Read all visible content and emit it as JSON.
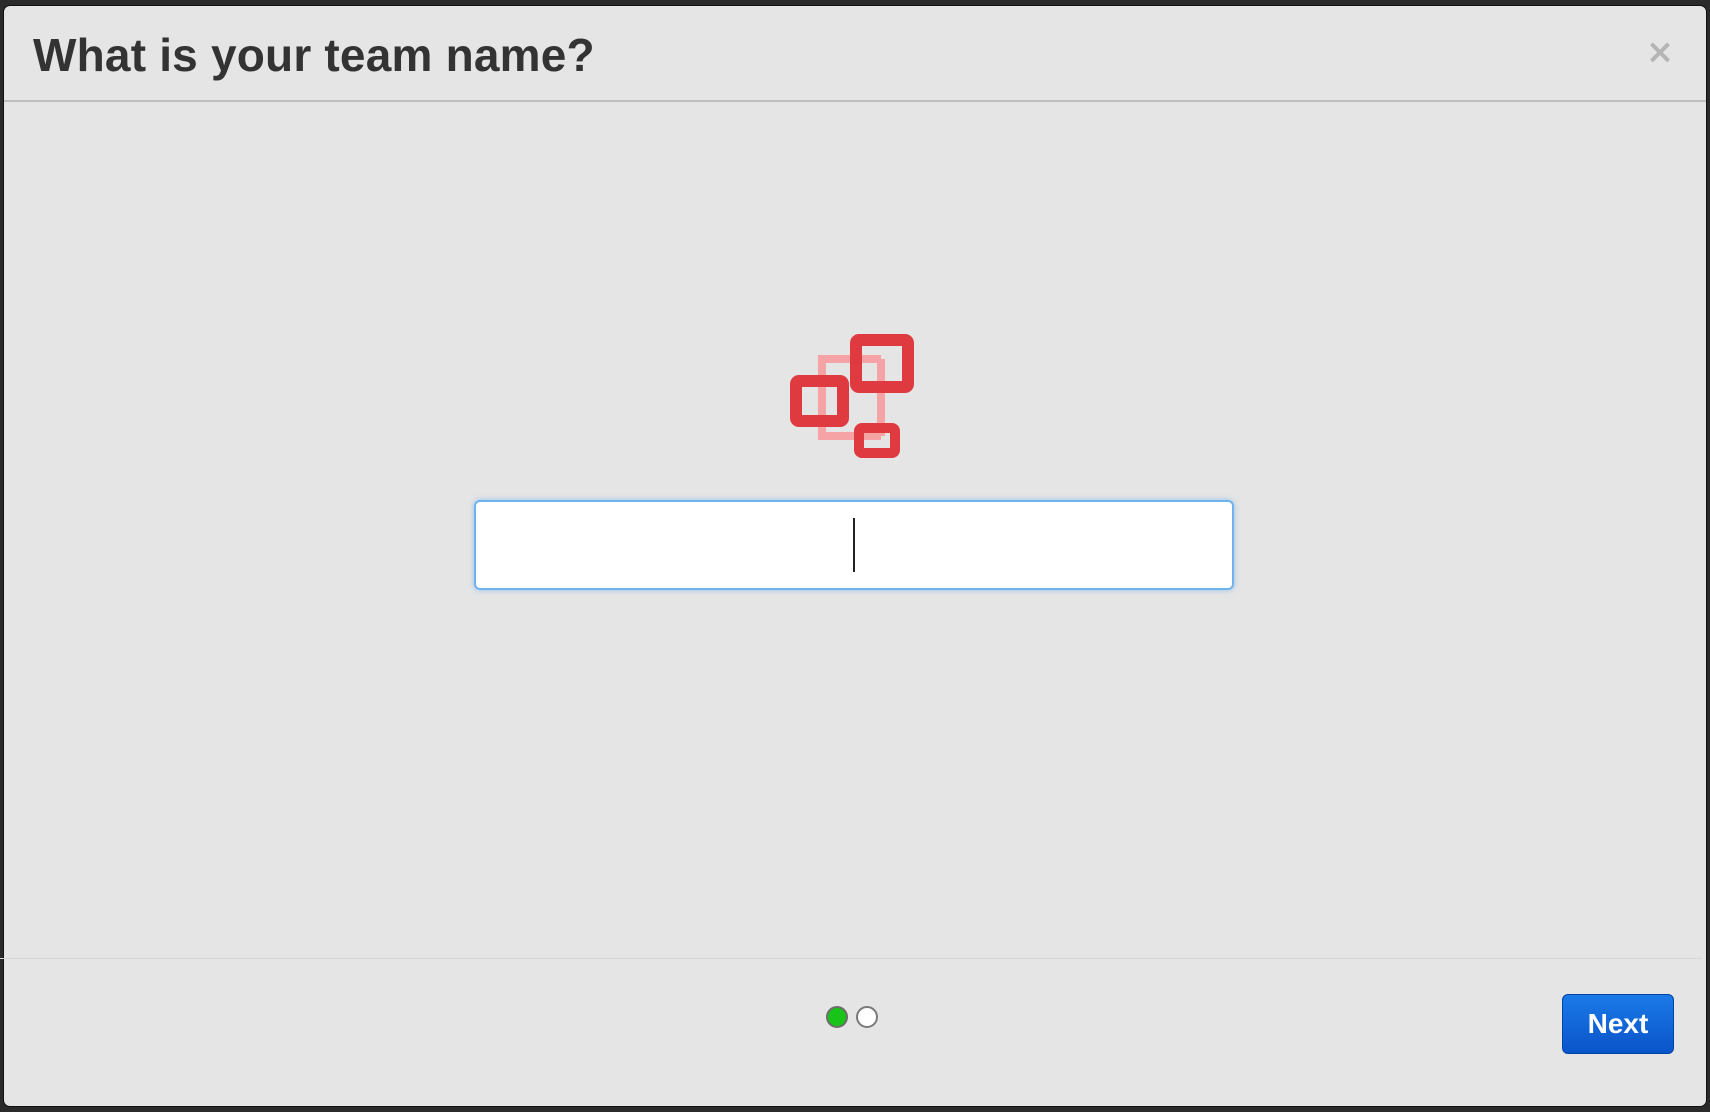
{
  "dialog": {
    "title": "What is your team name?",
    "close_label": "×"
  },
  "team_name_input": {
    "value": "",
    "placeholder": ""
  },
  "icon": {
    "name": "team-network-icon",
    "color": "#de3a40",
    "connector_color": "#f6a3a6"
  },
  "steps": {
    "current": 1,
    "total": 2,
    "active_color": "#18c418"
  },
  "footer": {
    "next_label": "Next",
    "next_color": "#0a5fd6"
  }
}
